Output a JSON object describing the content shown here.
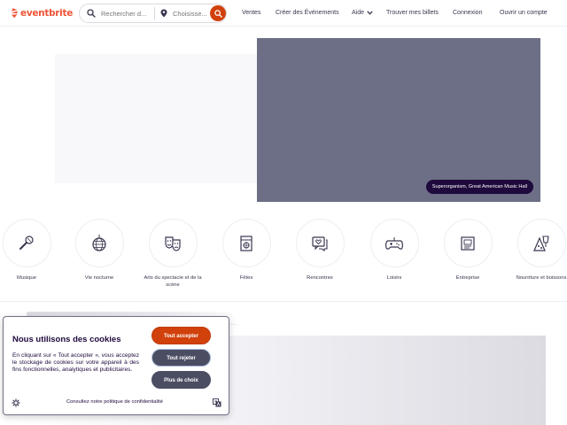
{
  "header": {
    "logo_text": "eventbrite",
    "brand_color": "#f05537",
    "search_placeholder": "Rechercher d...",
    "location_placeholder": "Choisisse...",
    "nav": [
      {
        "label": "Ventes"
      },
      {
        "label": "Créer des Événements"
      },
      {
        "label": "Aide"
      },
      {
        "label": "Trouver mes billets"
      },
      {
        "label": "Connexion"
      },
      {
        "label": "Ouvrir un compte"
      }
    ]
  },
  "hero": {
    "caption": "Superorganism, Great American Music Hall"
  },
  "categories": [
    {
      "label": "Musique",
      "icon": "microphone-icon"
    },
    {
      "label": "Vie nocturne",
      "icon": "disco-ball-icon"
    },
    {
      "label": "Arts du spectacle et de la scène",
      "icon": "theater-masks-icon"
    },
    {
      "label": "Fêtes",
      "icon": "calendar-icon"
    },
    {
      "label": "Rencontres",
      "icon": "chat-heart-icon"
    },
    {
      "label": "Loisirs",
      "icon": "gamepad-icon"
    },
    {
      "label": "Entreprise",
      "icon": "briefcase-icon"
    },
    {
      "label": "Nourriture et boissons",
      "icon": "food-drink-icon"
    }
  ],
  "cookie": {
    "title": "Nous utilisons des cookies",
    "body": "En cliquant sur « Tout accepter », vous acceptez le stockage de cookies sur votre appareil à des fins fonctionnelles, analytiques et publicitaires.",
    "accept_label": "Tout accepter",
    "reject_label": "Tout rejeter",
    "more_label": "Plus de choix",
    "policy_link": "Consultez notre politique de confidentialité",
    "accent": "#d1410c"
  }
}
